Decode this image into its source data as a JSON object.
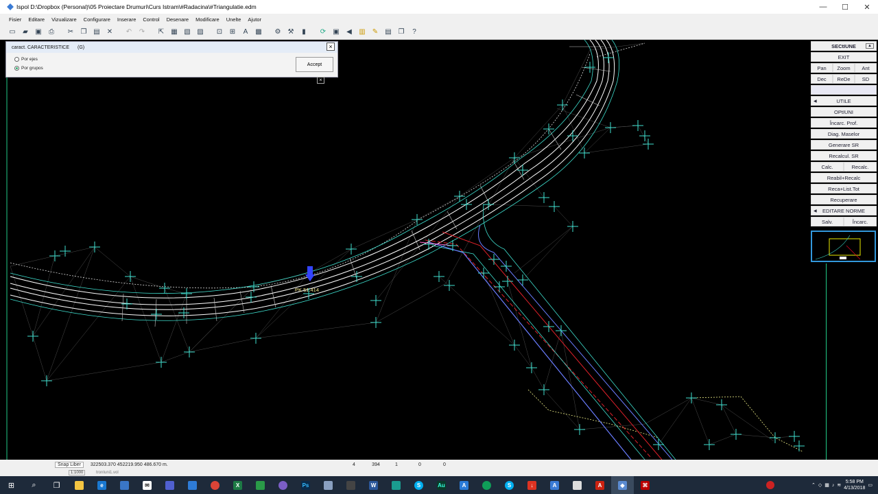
{
  "window": {
    "title": "Ispol  D:\\Dropbox (Personal)\\05 Proiectare Drumuri\\Curs Istram\\#Radacina\\#Triangulatie.edm",
    "minimize": "—",
    "maximize": "☐",
    "close": "✕"
  },
  "menu": [
    "Fisier",
    "Editare",
    "Vizualizare",
    "Configurare",
    "Inserare",
    "Control",
    "Desenare",
    "Modificare",
    "Unelte",
    "Ajutor"
  ],
  "toolbar_icons": [
    "new-icon",
    "open-icon",
    "save-icon",
    "print-icon",
    "cut-icon",
    "copy-icon",
    "paste-icon",
    "delete-icon",
    "undo-icon",
    "redo-icon"
  ],
  "dialog": {
    "title": "caract. CARACTERISTICE",
    "code": "(G)",
    "options": [
      "Por ejes",
      "Por grupos"
    ],
    "selected": "Por grupos",
    "accept": "Accept"
  },
  "canvas": {
    "station_label": "PK 51.414"
  },
  "panel": {
    "header": "SECtIUNE",
    "exit": "EXIT",
    "row1": [
      "Pan",
      "Zoom",
      "Ant"
    ],
    "row2": [
      "Dec",
      "ReDe",
      "SD"
    ],
    "utile": "UTILE",
    "optiuni": "OPtIUNI",
    "incarc_prof": "Încarc. Prof.",
    "diag_maselor": "Diag. Maselor",
    "generare_sr": "Generare  SR",
    "recalcul_sr": "Recalcul. SR",
    "calc": "Calc.",
    "recalc": "Recalc.",
    "reabil": "Reabil+Recalc",
    "reca_list": "Reca+List.Tot",
    "recuperare": "Recuperare",
    "editare_norme": "EDITARE NORME",
    "salv": "Salv.",
    "incarc": "Încarc."
  },
  "status": {
    "snap": "Snap Liber",
    "coords": "322503.370    452219.950    486.670      m.",
    "scale": "1:1000",
    "v1": "4",
    "v2": "394",
    "v3": "1",
    "v4": "0",
    "v5": "0",
    "sub": "tronIuni1.vol"
  },
  "taskbar": {
    "time": "5:58 PM",
    "date": "4/13/2018"
  },
  "colors": {
    "cyan": "#3fe0d0",
    "red": "#e0202a",
    "white": "#ffffff",
    "yellow": "#f0e68c"
  }
}
